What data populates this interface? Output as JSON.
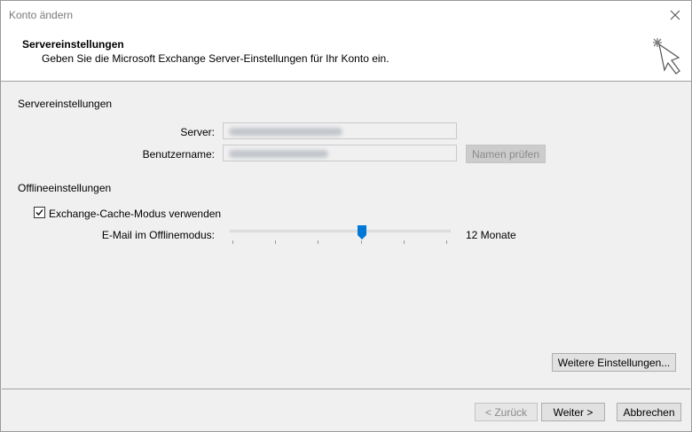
{
  "window": {
    "title": "Konto ändern"
  },
  "header": {
    "title": "Servereinstellungen",
    "subtitle": "Geben Sie die Microsoft Exchange Server-Einstellungen für Ihr Konto ein."
  },
  "server_section": {
    "heading": "Servereinstellungen",
    "server_label": "Server:",
    "username_label": "Benutzername:",
    "check_names_button": "Namen prüfen"
  },
  "offline_section": {
    "heading": "Offlineeinstellungen",
    "cache_mode_label": "Exchange-Cache-Modus verwenden",
    "cache_mode_checked": true,
    "offline_mail_label": "E-Mail im Offlinemodus:",
    "offline_mail_value": "12 Monate",
    "slider_fraction": 0.6
  },
  "more_settings_button": "Weitere Einstellungen...",
  "footer": {
    "back_button": "< Zurück",
    "next_button": "Weiter >",
    "cancel_button": "Abbrechen"
  },
  "icons": {
    "close": "close-icon",
    "wizard": "wizard-wand-icon",
    "checkbox": "check-icon",
    "slider": "slider-thumb"
  },
  "colors": {
    "accent": "#0078d7",
    "background": "#f0f0f0",
    "header_background": "#ffffff"
  }
}
